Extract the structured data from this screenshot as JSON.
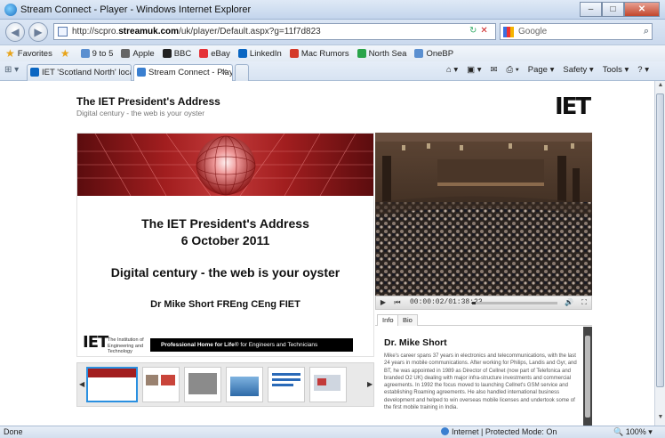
{
  "window": {
    "title": "Stream Connect - Player - Windows Internet Explorer",
    "controls": [
      "–",
      "□",
      "✕"
    ]
  },
  "address_bar": {
    "url_prefix": "http://scpro.",
    "url_domain": "streamuk.com",
    "url_path": "/uk/player/Default.aspx?g=11f7d823",
    "search_placeholder": "Google"
  },
  "favorites_bar": {
    "favorites_label": "Favorites",
    "items": [
      {
        "label": "9 to 5",
        "color": "#5a8fd0"
      },
      {
        "label": "Apple",
        "color": "#666666"
      },
      {
        "label": "BBC",
        "color": "#222222"
      },
      {
        "label": "eBay",
        "color": "#e53238"
      },
      {
        "label": "LinkedIn",
        "color": "#0a66c2"
      },
      {
        "label": "Mac Rumors",
        "color": "#d43a2a"
      },
      {
        "label": "North Sea",
        "color": "#2aa44a"
      },
      {
        "label": "OneBP",
        "color": "#5a8fd0"
      }
    ]
  },
  "tabs": [
    {
      "label": "IET 'Scotland North' local ...",
      "color": "#0a66c2",
      "active": false
    },
    {
      "label": "Stream Connect - Player",
      "color": "#3a7fd0",
      "active": true
    }
  ],
  "command_bar": [
    "Page ▾",
    "Safety ▾",
    "Tools ▾"
  ],
  "page": {
    "title": "The IET President's Address",
    "subtitle": "Digital century - the web is your oyster",
    "logo": "IET"
  },
  "slide": {
    "title_line1": "The IET President's Address",
    "title_line2": "6 October 2011",
    "subtitle": "Digital century - the web is your oyster",
    "presenter": "Dr Mike Short FREng CEng FIET",
    "footer_logo": "IET",
    "footer_institution": "The Institution of Engineering and Technology",
    "footer_tagline_bold": "Professional Home for Life",
    "footer_tagline_rest": "® for Engineers and Technicians"
  },
  "player": {
    "time": "00:00:02/01:38:23",
    "progress_fraction": 0.0
  },
  "info": {
    "tabs": [
      "Info",
      "Bio"
    ],
    "name": "Dr. Mike Short",
    "bio": "Mike's career spans 37 years in electronics and telecommunications, with the last 24 years in mobile communications. After working for Philips, Landis and Gyr, and BT, he was appointed in 1989 as Director of Cellnet (now part of Telefonica and branded O2 UK) dealing with major infra-structure investments and commercial agreements. In 1992 the focus moved to launching Cellnet's GSM service and establishing Roaming agreements. He also handled international business development and helped to win overseas mobile licenses and undertook some of the first mobile training in India."
  },
  "status_bar": {
    "left": "Done",
    "zone": "Internet | Protected Mode: On",
    "zoom": "100%"
  }
}
